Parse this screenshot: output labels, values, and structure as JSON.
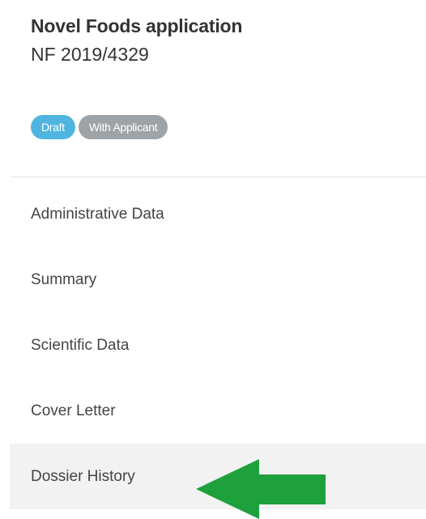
{
  "application": {
    "title": "Novel Foods application",
    "reference": "NF 2019/4329"
  },
  "badges": [
    {
      "label": "Draft",
      "color": "#4fb5e0"
    },
    {
      "label": "With Applicant",
      "color": "#9ea3a8"
    }
  ],
  "nav": {
    "items": [
      {
        "label": "Administrative Data"
      },
      {
        "label": "Summary"
      },
      {
        "label": "Scientific Data"
      },
      {
        "label": "Cover Letter"
      },
      {
        "label": "Dossier History",
        "highlighted": true
      }
    ]
  },
  "annotation": {
    "arrow_color": "#1ea03c",
    "arrow_direction": "left",
    "points_to": "Dossier History"
  }
}
